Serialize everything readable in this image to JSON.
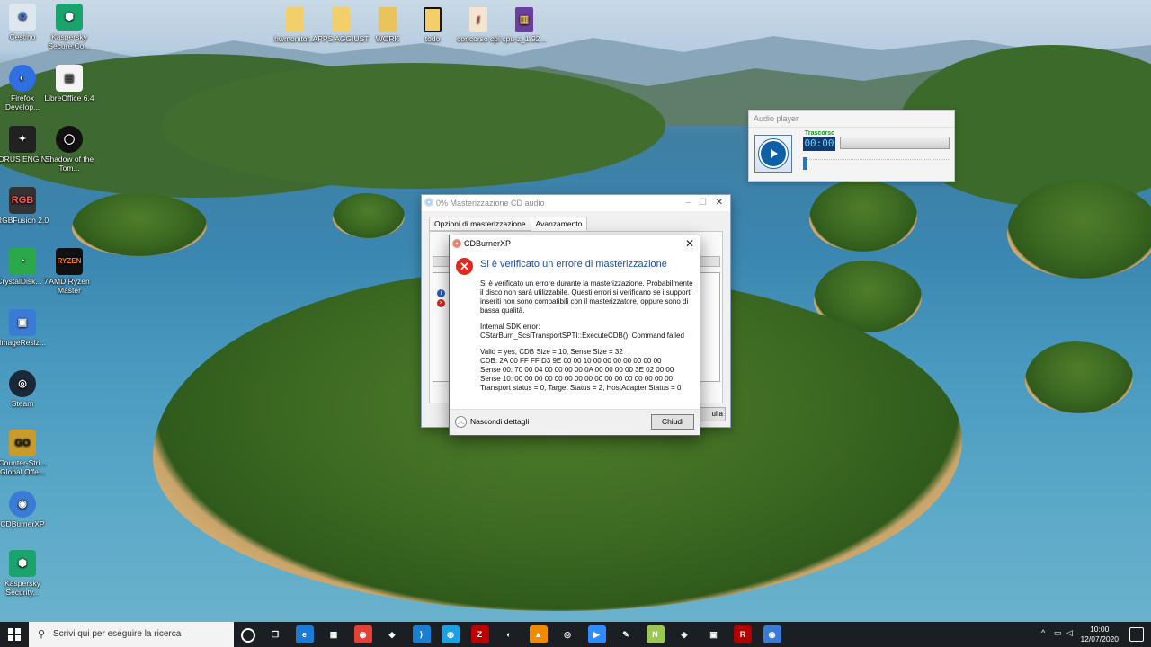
{
  "desktop_icons": [
    {
      "label": "Cestino",
      "icon": "recycle-bin-icon",
      "color": "#dfe7ee"
    },
    {
      "label": "Kaspersky Secure Co...",
      "icon": "kaspersky-secure-connection-icon",
      "color": "#1aa36d"
    },
    {
      "label": "Firefox Develop...",
      "icon": "firefox-developer-icon",
      "color": "#2f6fe0"
    },
    {
      "label": "LibreOffice 6.4",
      "icon": "libreoffice-icon",
      "color": "#f4f4f4"
    },
    {
      "label": "AORUS ENGINE",
      "icon": "aorus-engine-icon",
      "color": "#222222"
    },
    {
      "label": "Shadow of the Tom...",
      "icon": "shadow-of-tomb-raider-icon",
      "color": "#111111"
    },
    {
      "label": "RGBFusion 2.0",
      "icon": "rgb-fusion-icon",
      "color": "#333333"
    },
    {
      "label": "CrystalDisk... 7",
      "icon": "crystaldisk-icon",
      "color": "#2aa84a"
    },
    {
      "label": "AMD Ryzen Master",
      "icon": "amd-ryzen-master-icon",
      "color": "#111111"
    },
    {
      "label": "ImageResiz...",
      "icon": "image-resizer-icon",
      "color": "#3a7bd5"
    },
    {
      "label": "Steam",
      "icon": "steam-icon",
      "color": "#1b2838"
    },
    {
      "label": "Counter-Stri... Global Offe...",
      "icon": "counter-strike-icon",
      "color": "#c89b2a"
    },
    {
      "label": "CDBurnerXP",
      "icon": "cdburnerxp-icon",
      "color": "#3a7bd5"
    },
    {
      "label": "Kaspersky Security...",
      "icon": "kaspersky-security-icon",
      "color": "#1aa36d"
    }
  ],
  "top_folders": [
    {
      "label": "hwmonitor...",
      "icon": "folder-icon"
    },
    {
      "label": "APPS AGGIUST",
      "icon": "folder-icon"
    },
    {
      "label": "WORK",
      "icon": "folder-icon"
    },
    {
      "label": "todo",
      "icon": "folder-icon"
    },
    {
      "label": "concorso cpl",
      "icon": "pdf-file-icon"
    },
    {
      "label": "cpu-z_1.92...",
      "icon": "archive-icon"
    }
  ],
  "audio_player": {
    "title": "Audio player",
    "elapsed_label": "Trascorso",
    "time": "00:00"
  },
  "burn_window": {
    "title": "0% Masterizzazione CD audio",
    "tabs": [
      "Opzioni di masterizzazione",
      "Avanzamento"
    ],
    "active_tab": "Avanzamento",
    "cancel_label": "Annulla",
    "cancel_visible": "ulla"
  },
  "error_dialog": {
    "title": "CDBurnerXP",
    "heading": "Si è verificato un errore di masterizzazione",
    "message": "Si è verificato un errore durante la masterizzazione. Probabilmente il disco non sarà utilizzabile. Questi errori si verificano se i supporti inseriti non sono compatibili con il masterizzatore, oppure sono di bassa qualità.",
    "sdk_error_label": "Internal SDK error:",
    "sdk_error": "CStarBurn_ScsiTransportSPTI::ExecuteCDB(): Command failed",
    "details": [
      "Valid = yes, CDB Size = 10, Sense Size = 32",
      "CDB: 2A 00 FF FF D3 9E 00 00 10 00 00 00 00 00 00 00",
      "Sense 00: 70 00 04 00 00 00 00 0A 00 00 00 00 3E 02 00 00",
      "Sense 10: 00 00 00 00 00 00 00 00 00 00 00 00 00 00 00 00",
      "Transport status = 0, Target Status = 2, HostAdapter Status = 0"
    ],
    "toggle_label": "Nascondi dettagli",
    "close_label": "Chiudi"
  },
  "taskbar": {
    "search_placeholder": "Scrivi qui per eseguire la ricerca",
    "pinned": [
      {
        "name": "task-view-icon",
        "glyph": "❒",
        "color": "#1b1f24"
      },
      {
        "name": "edge-icon",
        "glyph": "e",
        "color": "#1d7bd8"
      },
      {
        "name": "store-icon",
        "glyph": "▦",
        "color": "#1b1f24"
      },
      {
        "name": "chrome-icon",
        "glyph": "◉",
        "color": "#e34133"
      },
      {
        "name": "git-icon",
        "glyph": "◆",
        "color": "#1b1f24"
      },
      {
        "name": "vscode-icon",
        "glyph": "⟩",
        "color": "#1b7fd1"
      },
      {
        "name": "app-icon",
        "glyph": "◍",
        "color": "#1ba1e2"
      },
      {
        "name": "filezilla-icon",
        "glyph": "Z",
        "color": "#bf0000"
      },
      {
        "name": "firefox-icon",
        "glyph": "◐",
        "color": "#1b1f24"
      },
      {
        "name": "vlc-icon",
        "glyph": "▲",
        "color": "#f08a00"
      },
      {
        "name": "steam-icon",
        "glyph": "◎",
        "color": "#1b1f24"
      },
      {
        "name": "zoom-icon",
        "glyph": "▶",
        "color": "#2d8cff"
      },
      {
        "name": "tool-icon",
        "glyph": "✎",
        "color": "#1b1f24"
      },
      {
        "name": "notepadpp-icon",
        "glyph": "N",
        "color": "#9bc850"
      },
      {
        "name": "gpu-icon",
        "glyph": "◈",
        "color": "#1b1f24"
      },
      {
        "name": "display-icon",
        "glyph": "▣",
        "color": "#1b1f24"
      },
      {
        "name": "ryzen-master-icon",
        "glyph": "R",
        "color": "#b00000"
      },
      {
        "name": "cdburnerxp-taskbar-icon",
        "glyph": "◉",
        "color": "#3a7bd5"
      }
    ],
    "tray": {
      "chevron": "^",
      "time": "10:00",
      "date": "12/07/2020"
    }
  }
}
